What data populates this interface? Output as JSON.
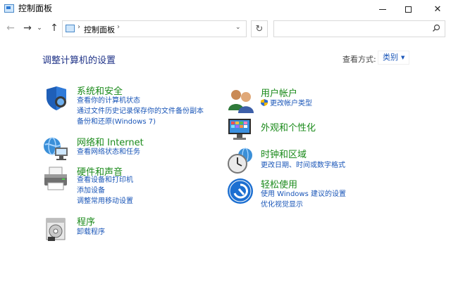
{
  "window": {
    "title": "控制面板"
  },
  "address": {
    "path": "控制面板",
    "sep": "›",
    "search_placeholder": ""
  },
  "content": {
    "heading": "调整计算机的设置",
    "view_by_label": "查看方式:",
    "view_by_value": "类别"
  },
  "left": [
    {
      "title": "系统和安全",
      "icon": "security-shield-icon",
      "links": [
        "查看你的计算机状态",
        "通过文件历史记录保存你的文件备份副本",
        "备份和还原(Windows 7)"
      ]
    },
    {
      "title": "网络和 Internet",
      "icon": "network-globe-icon",
      "links": [
        "查看网络状态和任务"
      ]
    },
    {
      "title": "硬件和声音",
      "icon": "printer-icon",
      "links": [
        "查看设备和打印机",
        "添加设备",
        "调整常用移动设置"
      ]
    },
    {
      "title": "程序",
      "icon": "programs-icon",
      "links": [
        "卸载程序"
      ]
    }
  ],
  "right": [
    {
      "title": "用户帐户",
      "icon": "user-accounts-icon",
      "links": [
        "更改帐户类型"
      ]
    },
    {
      "title": "外观和个性化",
      "icon": "appearance-monitor-icon",
      "links": []
    },
    {
      "title": "时钟和区域",
      "icon": "clock-globe-icon",
      "links": [
        "更改日期、时间或数字格式"
      ]
    },
    {
      "title": "轻松使用",
      "icon": "ease-of-access-icon",
      "links": [
        "使用 Windows 建议的设置",
        "优化视觉显示"
      ]
    }
  ],
  "colors": {
    "title_green": "#1a8a1a",
    "link_blue": "#1a56b8",
    "heading_blue": "#1e3287"
  }
}
